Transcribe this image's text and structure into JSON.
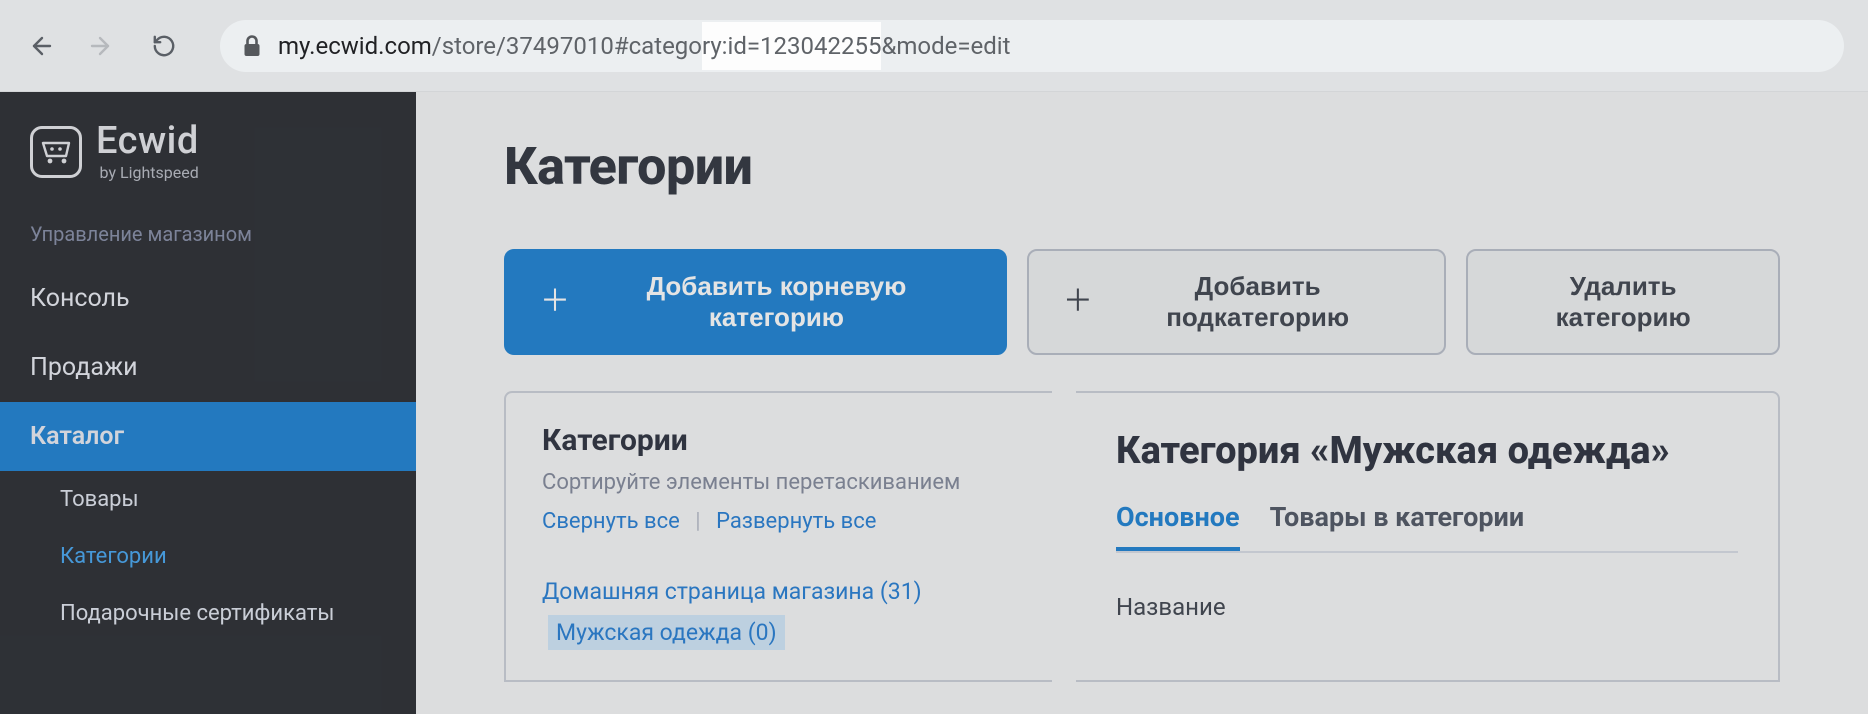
{
  "browser": {
    "url_host": "my.ecwid.com",
    "url_path_pre": "/store/37497010#catego",
    "url_highlight": "ry:id=123042255",
    "url_path_post": "&mode=edit"
  },
  "logo": {
    "name": "Ecwid",
    "sub": "by Lightspeed"
  },
  "sidebar": {
    "heading": "Управление магазином",
    "items": [
      "Консоль",
      "Продажи",
      "Каталог"
    ],
    "sub_items": [
      "Товары",
      "Категории",
      "Подарочные сертификаты"
    ]
  },
  "page": {
    "title": "Категории",
    "btn_add_root": "Добавить корневую категорию",
    "btn_add_sub": "Добавить подкатегорию",
    "btn_delete": "Удалить категорию"
  },
  "left_panel": {
    "heading": "Категории",
    "hint": "Сортируйте элементы перетаскиванием",
    "collapse": "Свернуть все",
    "expand": "Развернуть все",
    "tree_root": "Домашняя страница магазина (31)",
    "tree_child": "Мужская одежда (0)"
  },
  "right_panel": {
    "heading": "Категория «Мужская одежда»",
    "tab_main": "Основное",
    "tab_products": "Товары в категории",
    "field_name": "Название"
  }
}
